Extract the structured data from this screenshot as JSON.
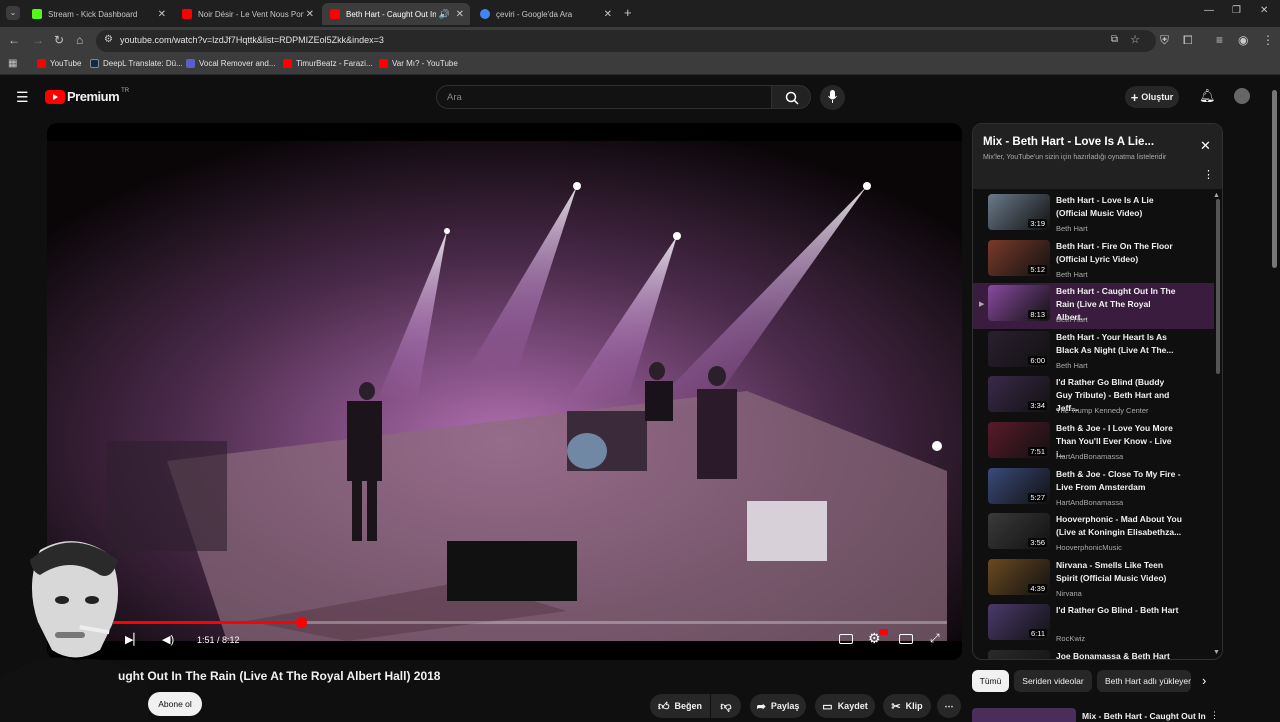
{
  "browser": {
    "tabs": [
      {
        "label": "Stream - Kick Dashboard",
        "color": "#53fc18",
        "active": false
      },
      {
        "label": "Noir Désir - Le Vent Nous Porte",
        "color": "#ff0000",
        "active": false
      },
      {
        "label": "Beth Hart - Caught Out In T",
        "color": "#ff0000",
        "active": true
      },
      {
        "label": "çeviri - Google'da Ara",
        "color": "#4285f4",
        "active": false
      }
    ],
    "url": "youtube.com/watch?v=lzdJf7Hqttk&list=RDPMIZEol5Zkk&index=3",
    "bookmarks": [
      {
        "label": "YouTube",
        "color": "#ff0000"
      },
      {
        "label": "DeepL Translate: Dü...",
        "color": "#0f2b46"
      },
      {
        "label": "Vocal Remover and...",
        "color": "#5b5fc7"
      },
      {
        "label": "TimurBeatz - Farazi...",
        "color": "#ff0000"
      },
      {
        "label": "Var Mı? - YouTube",
        "color": "#ff0000"
      }
    ]
  },
  "youtube": {
    "logo_text": "Premium",
    "logo_region": "TR",
    "search_placeholder": "Ara",
    "create_label": "Oluştur"
  },
  "player": {
    "time_current": "1:51",
    "time_total": "8:12",
    "time_display": "1:51 / 8:12",
    "progress_fraction": 0.226
  },
  "video": {
    "title": "ught Out In The Rain (Live At The Royal Albert Hall) 2018",
    "subscribe_label": "Abone ol",
    "actions": {
      "like": "Beğen",
      "share": "Paylaş",
      "save": "Kaydet",
      "clip": "Klip"
    }
  },
  "playlist": {
    "title": "Mix - Beth Hart - Love Is A Lie...",
    "subtitle": "Mix'ler, YouTube'un sizin için hazırladığı oynatma listeleridir",
    "items": [
      {
        "title": "Beth Hart - Love Is A Lie (Official Music Video)",
        "channel": "Beth Hart",
        "duration": "3:19",
        "current": false
      },
      {
        "title": "Beth Hart - Fire On The Floor (Official Lyric Video)",
        "channel": "Beth Hart",
        "duration": "5:12",
        "current": false
      },
      {
        "title": "Beth Hart - Caught Out In The Rain (Live At The Royal Albert...",
        "channel": "Beth Hart",
        "duration": "8:13",
        "current": true
      },
      {
        "title": "Beth Hart - Your Heart Is As Black As Night (Live At The...",
        "channel": "Beth Hart",
        "duration": "6:00",
        "current": false
      },
      {
        "title": "I'd Rather Go Blind (Buddy Guy Tribute) - Beth Hart and Jeff...",
        "channel": "The Trump Kennedy Center",
        "duration": "3:34",
        "current": false
      },
      {
        "title": "Beth & Joe - I Love You More Than You'll Ever Know - Live i...",
        "channel": "HartAndBonamassa",
        "duration": "7:51",
        "current": false
      },
      {
        "title": "Beth & Joe - Close To My Fire - Live From Amsterdam",
        "channel": "HartAndBonamassa",
        "duration": "5:27",
        "current": false
      },
      {
        "title": "Hooverphonic - Mad About You (Live at Koningin Elisabethza...",
        "channel": "HooverphonicMusic",
        "duration": "3:56",
        "current": false
      },
      {
        "title": "Nirvana - Smells Like Teen Spirit (Official Music Video)",
        "channel": "Nirvana",
        "duration": "4:39",
        "current": false
      },
      {
        "title": "I'd Rather Go Blind - Beth Hart",
        "channel": "RocKwiz",
        "duration": "6:11",
        "current": false
      },
      {
        "title": "Joe Bonamassa & Beth Hart",
        "channel": "",
        "duration": "",
        "current": false
      }
    ]
  },
  "chips": [
    "Tümü",
    "Seriden videolar",
    "Beth Hart adlı yükleyen"
  ],
  "next_mix_title": "Mix - Beth Hart - Caught Out In",
  "colors": {
    "accent_red": "#ff0000",
    "current_row_bg": "#3a1c3f",
    "page_bg": "#0f0f0f"
  }
}
